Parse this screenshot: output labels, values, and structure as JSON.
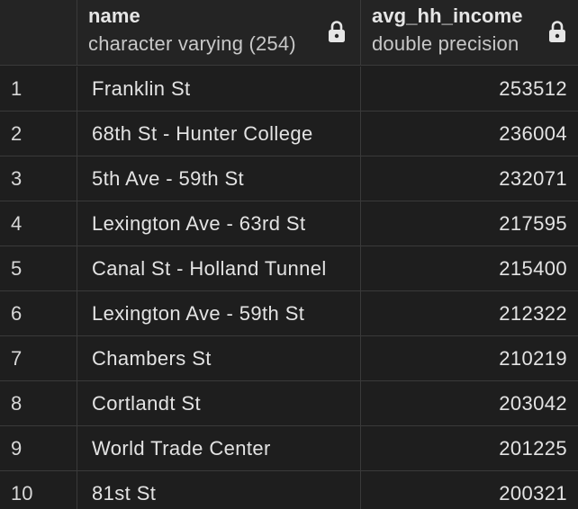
{
  "columns": [
    {
      "name": "name",
      "type": "character varying (254)"
    },
    {
      "name": "avg_hh_income",
      "type": "double precision"
    }
  ],
  "rows": [
    {
      "num": "1",
      "name": "Franklin St",
      "income": "253512"
    },
    {
      "num": "2",
      "name": "68th St - Hunter College",
      "income": "236004"
    },
    {
      "num": "3",
      "name": "5th Ave - 59th St",
      "income": "232071"
    },
    {
      "num": "4",
      "name": "Lexington Ave - 63rd St",
      "income": "217595"
    },
    {
      "num": "5",
      "name": "Canal St - Holland Tunnel",
      "income": "215400"
    },
    {
      "num": "6",
      "name": "Lexington Ave - 59th St",
      "income": "212322"
    },
    {
      "num": "7",
      "name": "Chambers St",
      "income": "210219"
    },
    {
      "num": "8",
      "name": "Cortlandt St",
      "income": "203042"
    },
    {
      "num": "9",
      "name": "World Trade Center",
      "income": "201225"
    },
    {
      "num": "10",
      "name": "81st St",
      "income": "200321"
    }
  ],
  "icons": {
    "column_lock": "lock-icon"
  },
  "colors": {
    "background": "#1e1e1e",
    "header_background": "#242424",
    "grid_lines": "#3a3a3a",
    "text": "#e3e3e3"
  }
}
